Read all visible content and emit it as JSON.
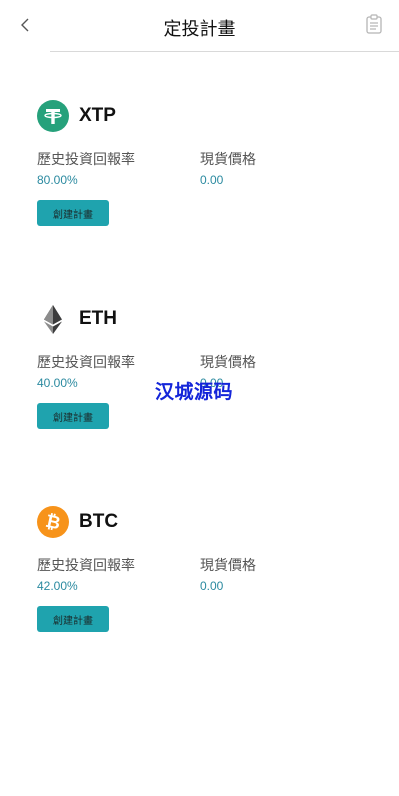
{
  "header": {
    "title": "定投計畫"
  },
  "labels": {
    "return_rate": "歷史投資回報率",
    "current_price": "現貨價格"
  },
  "plans": [
    {
      "coin": "XTP",
      "icon": "tether-icon",
      "icon_color": "#26a17b",
      "return_rate": "80.00%",
      "price": "0.00",
      "button": "創建計畫"
    },
    {
      "coin": "ETH",
      "icon": "ethereum-icon",
      "icon_color": "#3c3c3d",
      "return_rate": "40.00%",
      "price": "0.00",
      "button": "創建計畫"
    },
    {
      "coin": "BTC",
      "icon": "bitcoin-icon",
      "icon_color": "#f7931a",
      "return_rate": "42.00%",
      "price": "0.00",
      "button": "創建計畫"
    }
  ],
  "watermark": "汉城源码",
  "colors": {
    "accent": "#1fa3ae",
    "value_text": "#2b8aa0",
    "watermark": "#1425d9"
  }
}
